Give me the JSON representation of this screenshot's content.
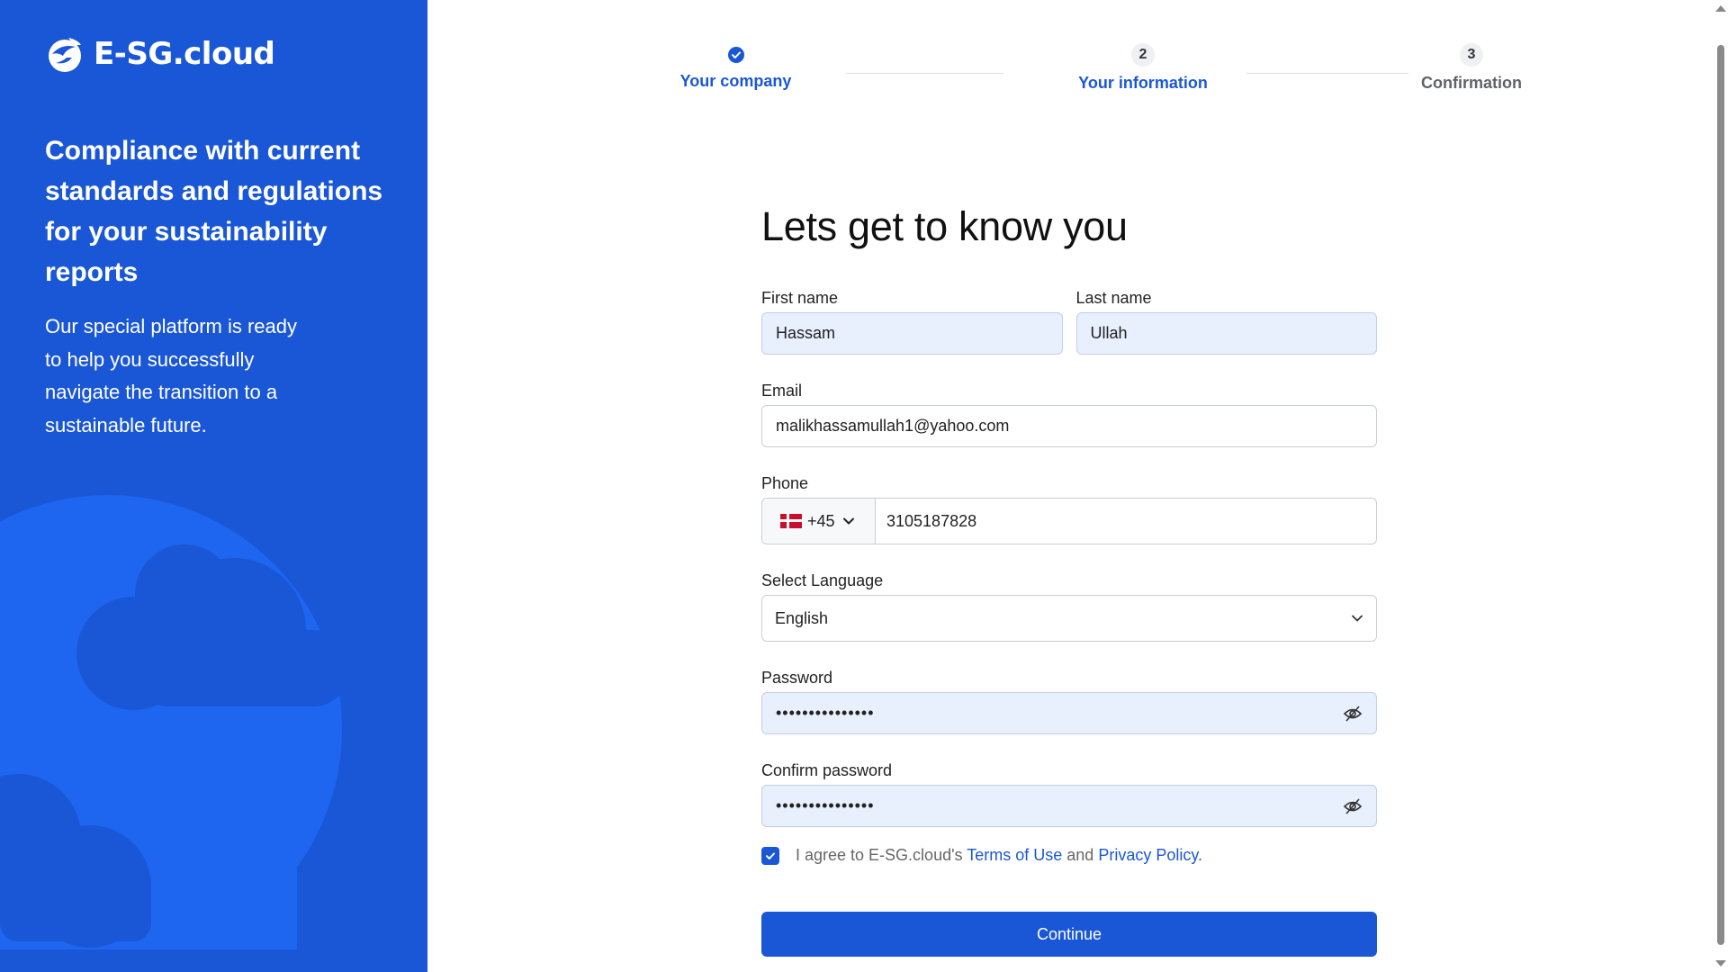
{
  "brand": {
    "logo_text": "E-SG.cloud",
    "headline": "Compliance with current standards and regulations for your sustainability reports",
    "subline": "Our special platform is ready to help you successfully navigate the transition to a sustainable future.",
    "panel_color": "#1a57d6"
  },
  "stepper": {
    "steps": [
      {
        "number": "",
        "label": "Your company",
        "state": "completed"
      },
      {
        "number": "2",
        "label": "Your information",
        "state": "active"
      },
      {
        "number": "3",
        "label": "Confirmation",
        "state": "upcoming"
      }
    ]
  },
  "form": {
    "title": "Lets get to know you",
    "first_name": {
      "label": "First name",
      "value": "Hassam"
    },
    "last_name": {
      "label": "Last name",
      "value": "Ullah"
    },
    "email": {
      "label": "Email",
      "value": "malikhassamullah1@yahoo.com"
    },
    "phone": {
      "label": "Phone",
      "country_code": "+45",
      "country_flag": "denmark-flag",
      "value": "3105187828"
    },
    "language": {
      "label": "Select Language",
      "value": "English"
    },
    "password": {
      "label": "Password",
      "value": "•••••••••••••••"
    },
    "confirm_password": {
      "label": "Confirm password",
      "value": "•••••••••••••••"
    },
    "agree": {
      "checked": true,
      "prefix": "I agree to E-SG.cloud's",
      "terms_link": "Terms of Use",
      "and": "and",
      "privacy_link": "Privacy Policy",
      "suffix": "."
    },
    "continue_label": "Continue"
  },
  "colors": {
    "accent": "#1a57d6",
    "filled_input": "#e8effd"
  }
}
